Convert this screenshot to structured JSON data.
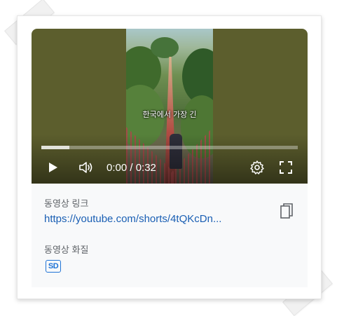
{
  "player": {
    "caption": "한국에서 가장 긴",
    "time": "0:00 / 0:32",
    "progress_fraction": 0.11
  },
  "info": {
    "link_label": "동영상 링크",
    "link_text": "https://youtube.com/shorts/4tQKcDn...",
    "quality_label": "동영상 화질",
    "quality_badge": "SD"
  },
  "icons": {
    "play": "play-icon",
    "volume": "volume-icon",
    "settings": "gear-icon",
    "fullscreen": "fullscreen-icon",
    "copy": "copy-icon"
  }
}
